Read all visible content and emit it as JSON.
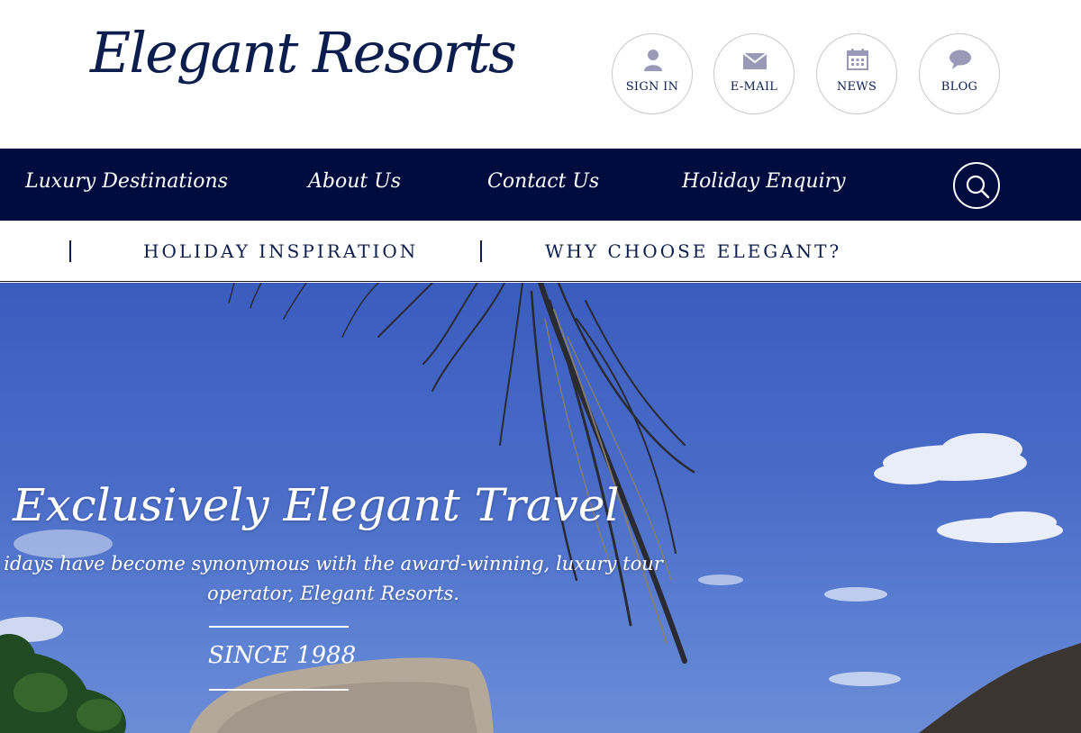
{
  "logo": {
    "text": "Elegant Resorts"
  },
  "header_icons": [
    {
      "label": "SIGN IN",
      "icon": "person-icon"
    },
    {
      "label": "E-MAIL",
      "icon": "envelope-icon"
    },
    {
      "label": "NEWS",
      "icon": "calendar-icon"
    },
    {
      "label": "BLOG",
      "icon": "speech-bubble-icon"
    }
  ],
  "main_nav": {
    "items": [
      "Luxury Destinations",
      "About Us",
      "Contact Us",
      "Holiday Enquiry"
    ],
    "search_icon": "search-icon"
  },
  "sub_nav": {
    "items": [
      "HOLIDAY INSPIRATION",
      "WHY CHOOSE ELEGANT?"
    ]
  },
  "hero": {
    "title": "Exclusively Elegant Travel",
    "subtitle_line1": "idays have become synonymous with the award-winning, luxury tour",
    "subtitle_line2": "operator, Elegant Resorts.",
    "since": "SINCE 1988"
  },
  "colors": {
    "brand_navy": "#0b1e4d",
    "nav_background": "#000c3d",
    "sky_blue": "#4a6cc8"
  }
}
